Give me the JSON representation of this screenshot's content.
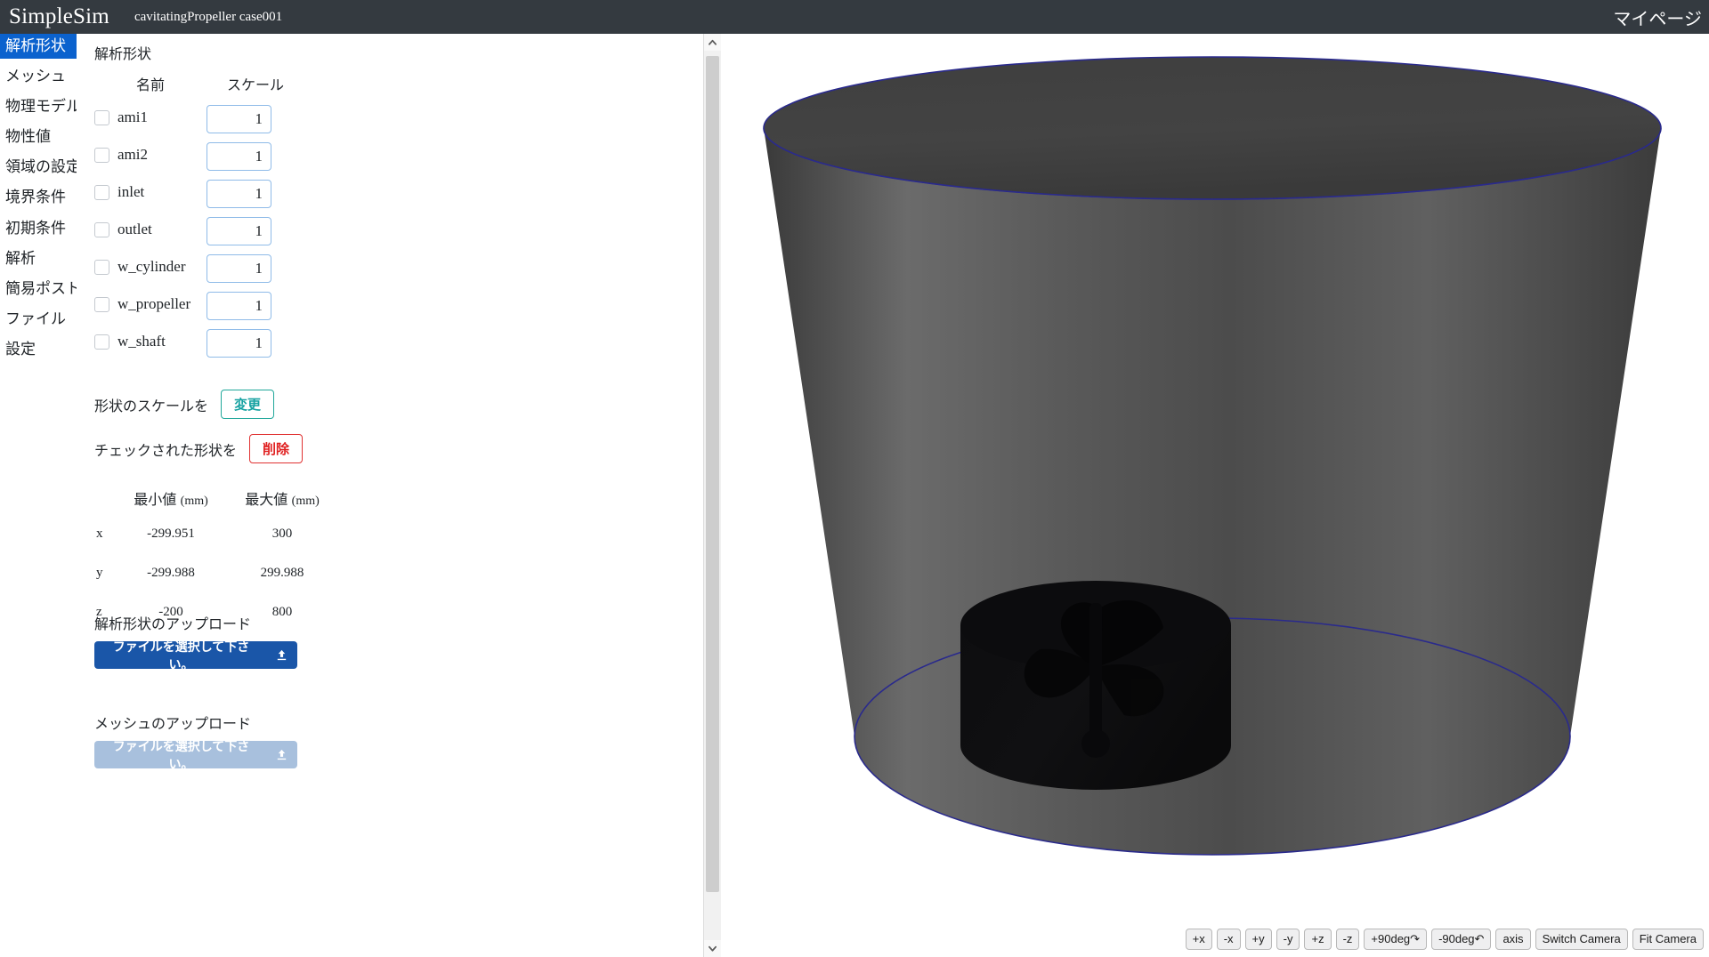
{
  "header": {
    "brand": "SimpleSim",
    "case_title": "cavitatingPropeller case001",
    "mypage_label": "マイページ",
    "background_color": "#343a40"
  },
  "sidebar": {
    "items": [
      {
        "label": "解析形状",
        "name": "sidebar-item-geometry",
        "active": true
      },
      {
        "label": "メッシュ",
        "name": "sidebar-item-mesh",
        "active": false
      },
      {
        "label": "物理モデル",
        "name": "sidebar-item-physics-model",
        "active": false
      },
      {
        "label": "物性値",
        "name": "sidebar-item-material-properties",
        "active": false
      },
      {
        "label": "領域の設定",
        "name": "sidebar-item-region-settings",
        "active": false
      },
      {
        "label": "境界条件",
        "name": "sidebar-item-boundary-conditions",
        "active": false
      },
      {
        "label": "初期条件",
        "name": "sidebar-item-initial-conditions",
        "active": false
      },
      {
        "label": "解析",
        "name": "sidebar-item-analysis",
        "active": false
      },
      {
        "label": "簡易ポスト",
        "name": "sidebar-item-simple-post",
        "active": false
      },
      {
        "label": "ファイル",
        "name": "sidebar-item-files",
        "active": false
      },
      {
        "label": "設定",
        "name": "sidebar-item-settings",
        "active": false
      }
    ],
    "active_color": "#0b62ce"
  },
  "panel": {
    "heading": "解析形状",
    "shapes_table": {
      "headers": {
        "blank": "",
        "name": "名前",
        "scale": "スケール"
      },
      "rows": [
        {
          "name": "ami1",
          "scale": "1",
          "checked": false
        },
        {
          "name": "ami2",
          "scale": "1",
          "checked": false
        },
        {
          "name": "inlet",
          "scale": "1",
          "checked": false
        },
        {
          "name": "outlet",
          "scale": "1",
          "checked": false
        },
        {
          "name": "w_cylinder",
          "scale": "1",
          "checked": false
        },
        {
          "name": "w_propeller",
          "scale": "1",
          "checked": false
        },
        {
          "name": "w_shaft",
          "scale": "1",
          "checked": false
        }
      ]
    },
    "scale_action": {
      "label": "形状のスケールを",
      "button_label": "変更",
      "button_color": "#17a2a2"
    },
    "delete_action": {
      "label": "チェックされた形状を",
      "button_label": "削除",
      "button_color": "#e02020"
    },
    "bounds": {
      "headers": {
        "blank": "",
        "min": "最小値",
        "max": "最大値",
        "unit": "(mm)"
      },
      "rows": [
        {
          "axis": "x",
          "min": "-299.951",
          "max": "300"
        },
        {
          "axis": "y",
          "min": "-299.988",
          "max": "299.988"
        },
        {
          "axis": "z",
          "min": "-200",
          "max": "800"
        }
      ]
    },
    "upload_geometry": {
      "caption": "解析形状のアップロード",
      "button_label": "ファイルを選択して下さい。",
      "icon": "upload-icon",
      "enabled": true,
      "color": "#1a56a8"
    },
    "upload_mesh": {
      "caption": "メッシュのアップロード",
      "button_label": "ファイルを選択して下さい。",
      "icon": "upload-icon",
      "enabled": false,
      "color": "#a8c0dd"
    }
  },
  "scrollbar": {
    "up_arrow": "▲",
    "down_arrow": "▼"
  },
  "viewport": {
    "model_description": "cylinder with inner propeller and shaft",
    "surface_color": "#4a4a4a",
    "edge_color": "#1c1c8a",
    "inner_color": "#0b0b0c",
    "background_color": "#ffffff"
  },
  "camera_toolbar": {
    "buttons": [
      {
        "label": "+x",
        "name": "camera-plus-x-button"
      },
      {
        "label": "-x",
        "name": "camera-minus-x-button"
      },
      {
        "label": "+y",
        "name": "camera-plus-y-button"
      },
      {
        "label": "-y",
        "name": "camera-minus-y-button"
      },
      {
        "label": "+z",
        "name": "camera-plus-z-button"
      },
      {
        "label": "-z",
        "name": "camera-minus-z-button"
      },
      {
        "label": "+90deg↷",
        "name": "camera-rotate-plus-90-button"
      },
      {
        "label": "-90deg↶",
        "name": "camera-rotate-minus-90-button"
      },
      {
        "label": "axis",
        "name": "camera-axis-button"
      },
      {
        "label": "Switch Camera",
        "name": "camera-switch-button"
      },
      {
        "label": "Fit Camera",
        "name": "camera-fit-button"
      }
    ]
  }
}
